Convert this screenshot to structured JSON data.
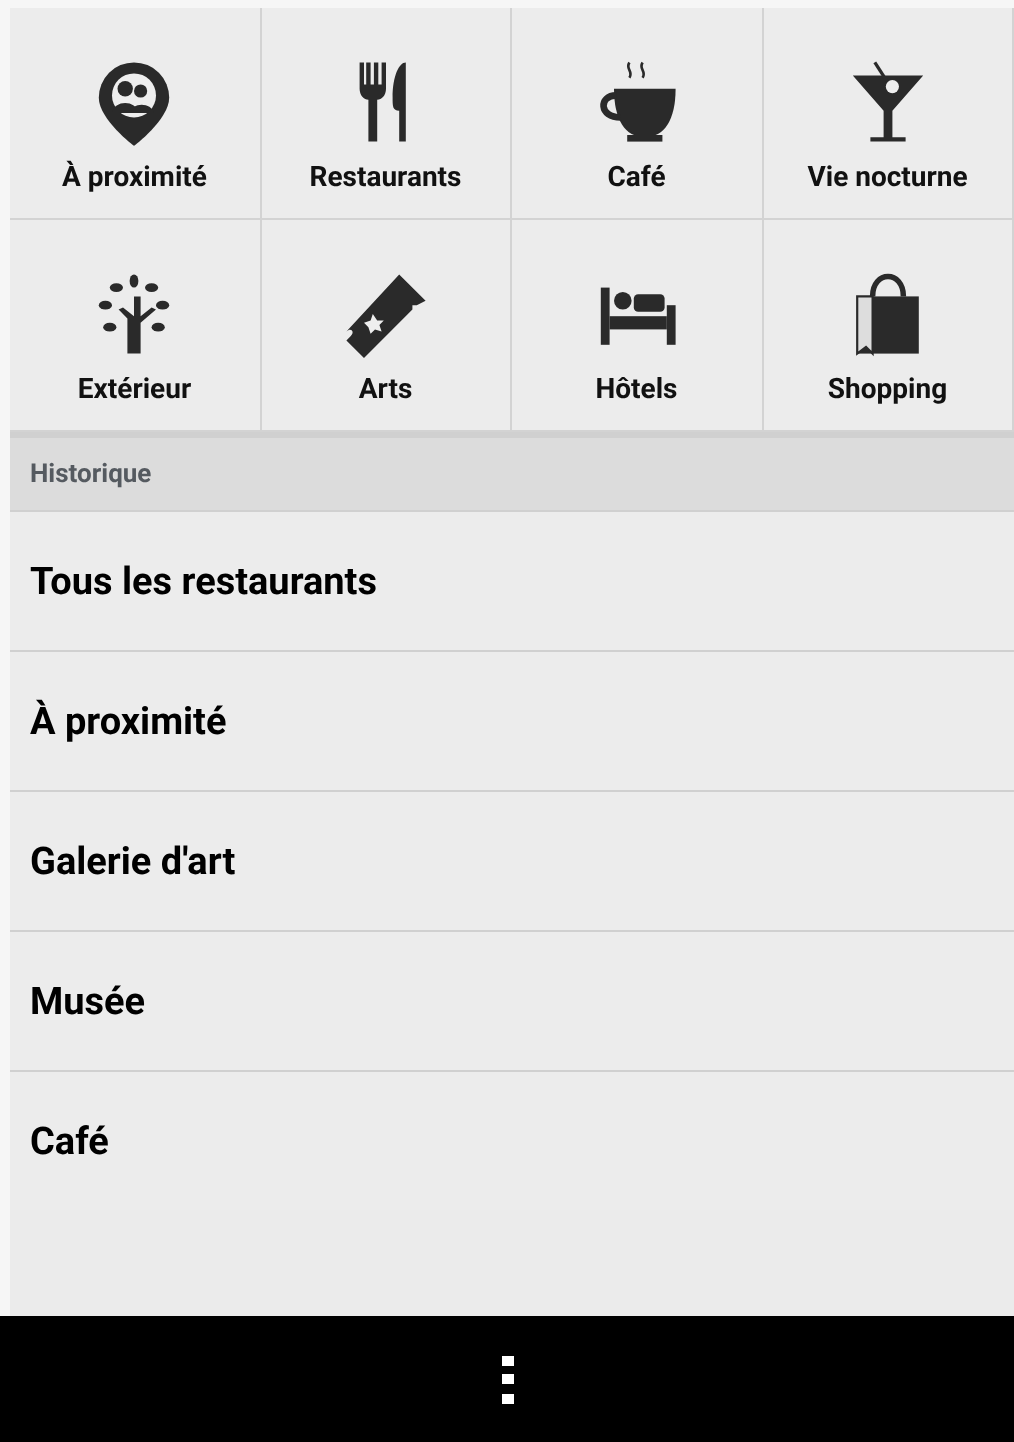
{
  "categories": [
    {
      "label": "À proximité",
      "kind": "nearby"
    },
    {
      "label": "Restaurants",
      "kind": "restaurant"
    },
    {
      "label": "Café",
      "kind": "cafe"
    },
    {
      "label": "Vie nocturne",
      "kind": "nightlife"
    },
    {
      "label": "Extérieur",
      "kind": "outdoor"
    },
    {
      "label": "Arts",
      "kind": "arts"
    },
    {
      "label": "Hôtels",
      "kind": "hotel"
    },
    {
      "label": "Shopping",
      "kind": "shopping"
    }
  ],
  "history": {
    "title": "Historique",
    "items": [
      "Tous les restaurants",
      "À proximité",
      "Galerie d'art",
      "Musée",
      "Café"
    ]
  }
}
